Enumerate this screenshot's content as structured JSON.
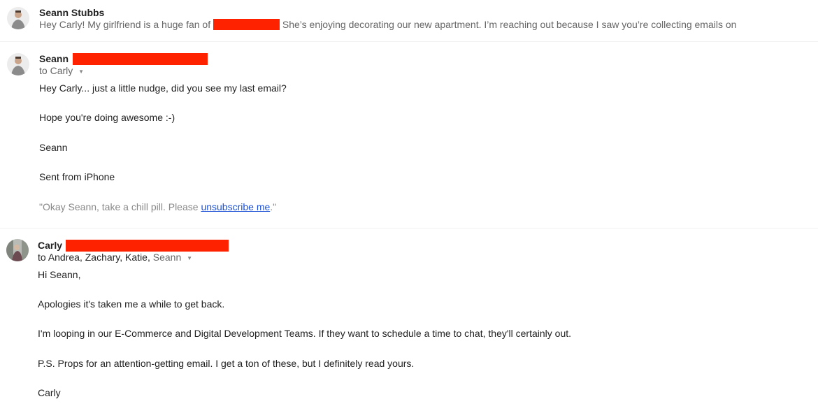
{
  "thread": {
    "collapsed_message": {
      "sender": "Seann Stubbs",
      "snippet_before": "Hey Carly! My girlfriend is a huge fan of",
      "snippet_after": "She’s enjoying decorating our new apartment. I’m reaching out because I saw you’re collecting emails on",
      "avatar_icon": "user-avatar-icon"
    },
    "messages": [
      {
        "sender_first": "Seann",
        "recipients_prefix": "to",
        "recipients": "Carly",
        "expand_icon": "caret-down-icon",
        "body": [
          "Hey Carly... just a little nudge, did you see my last email?",
          "Hope you're doing awesome :-)",
          "Seann",
          "Sent from iPhone"
        ],
        "annotation": {
          "before": "\"Okay Seann, take a chill pill. Please ",
          "link": "unsubscribe me",
          "after": ".\""
        }
      },
      {
        "sender_first": "Carly",
        "recipients_prefix": "to",
        "recipients_dark": "Andrea, Zachary, Katie,",
        "recipients_light": "Seann",
        "expand_icon": "caret-down-icon",
        "body": [
          "Hi Seann,",
          "Apologies it's taken me a while to get back.",
          "I'm looping in our E-Commerce and Digital Development Teams. If they want to schedule a time to chat, they'll certainly out.",
          "P.S. Props for an attention-getting email. I get a ton of these, but I definitely read yours.",
          "Carly"
        ]
      }
    ],
    "colors": {
      "redaction": "#ff2200",
      "link": "#1a4fd6",
      "muted_text": "#888888"
    }
  }
}
